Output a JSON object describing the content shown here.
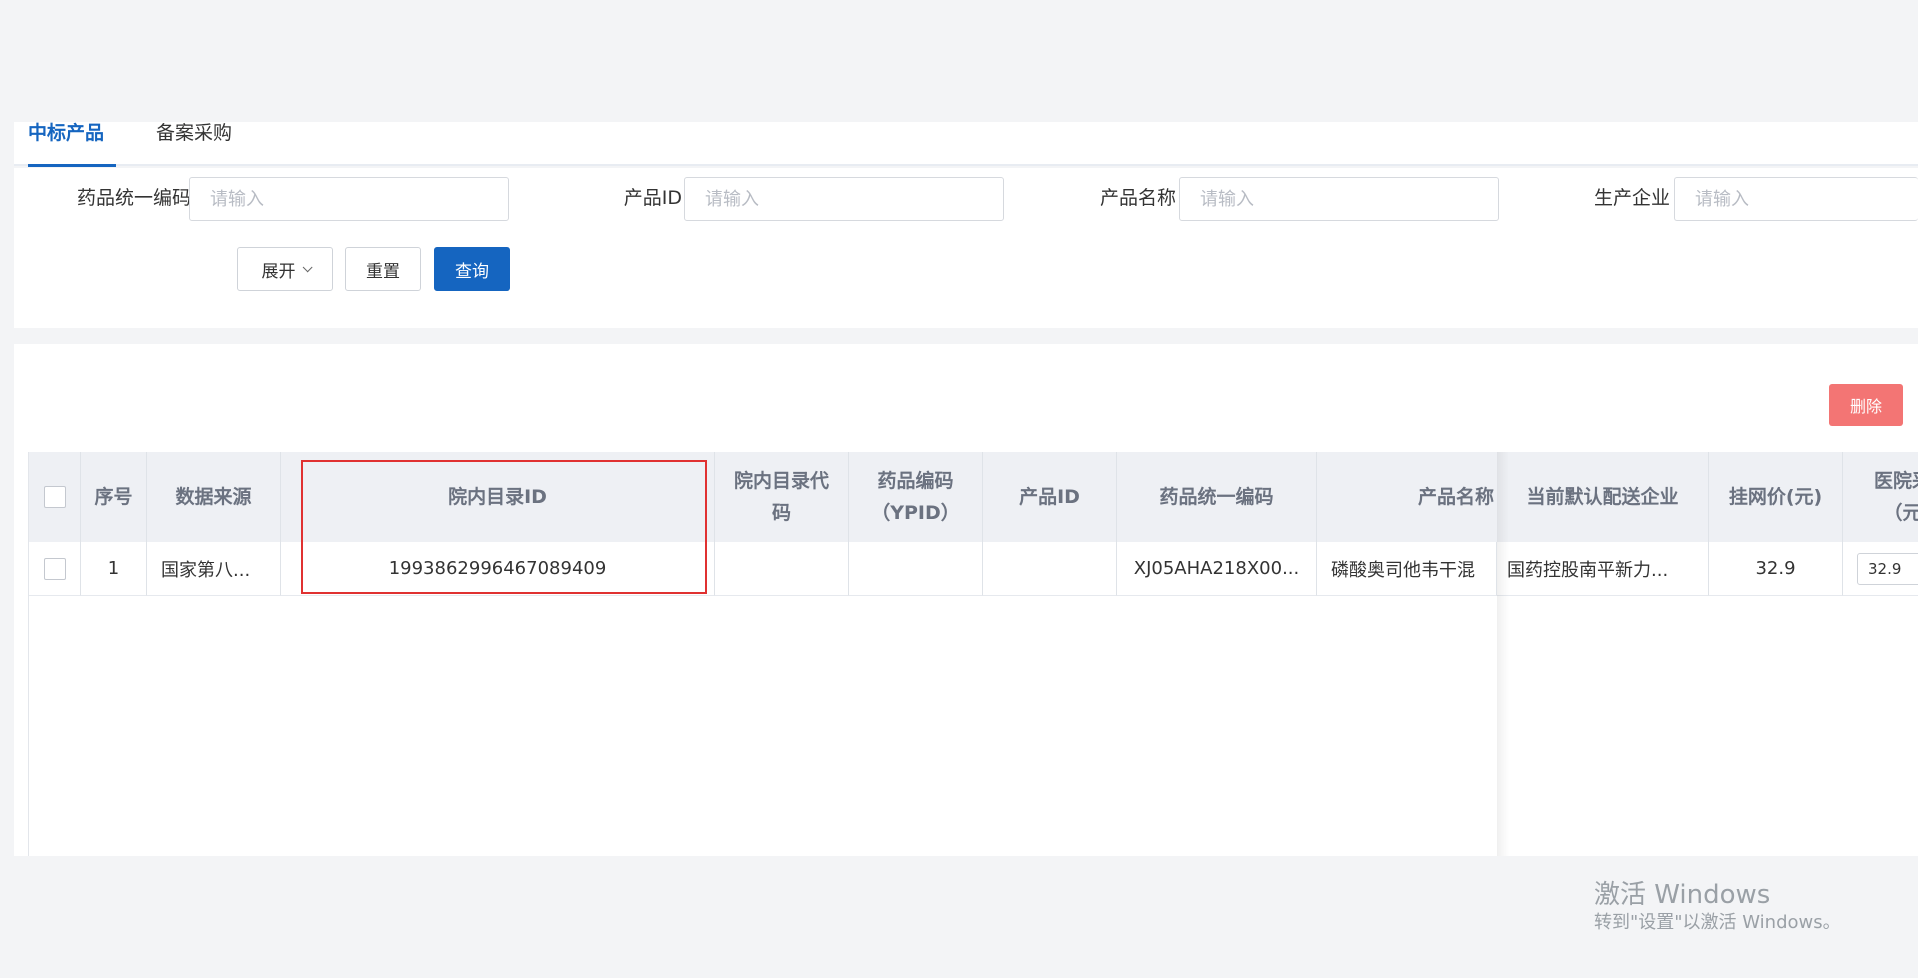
{
  "tabs": [
    {
      "label": "中标产品",
      "active": true
    },
    {
      "label": "备案采购",
      "active": false
    }
  ],
  "search": {
    "fields": [
      {
        "label": "药品统一编码",
        "placeholder": "请输入"
      },
      {
        "label": "产品ID",
        "placeholder": "请输入"
      },
      {
        "label": "产品名称",
        "placeholder": "请输入"
      },
      {
        "label": "生产企业",
        "placeholder": "请输入"
      }
    ],
    "expand_label": "展开",
    "reset_label": "重置",
    "query_label": "查询"
  },
  "table": {
    "delete_label": "删除",
    "headers": [
      "序号",
      "数据来源",
      "院内目录ID",
      "院内目录代码",
      "药品编码（YPID）",
      "产品ID",
      "药品统一编码",
      "产品名称",
      "当前默认配送企业",
      "挂网价(元)",
      "医院采（元"
    ],
    "rows": [
      {
        "index": "1",
        "source": "国家第八...",
        "catalog_id": "1993862996467089409",
        "catalog_code": "",
        "ypid": "",
        "product_id": "",
        "unified_code": "XJ05AHA218X00...",
        "product_name": "磷酸奥司他韦干混",
        "distributor": "国药控股南平新力...",
        "list_price": "32.9",
        "hospital_price": "32.9"
      }
    ]
  },
  "watermark": {
    "title": "激活 Windows",
    "subtitle": "转到\"设置\"以激活 Windows。"
  },
  "colors": {
    "primary": "#1565c0",
    "danger": "#f37574",
    "highlight": "#e03131"
  }
}
